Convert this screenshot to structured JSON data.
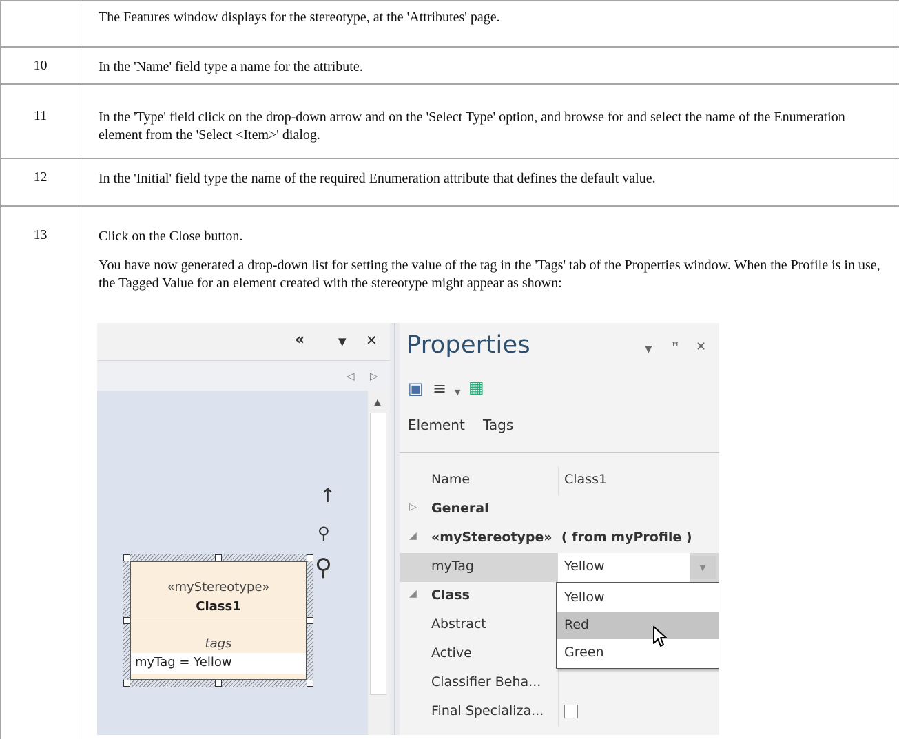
{
  "rows": [
    {
      "num": "",
      "text": "The Features window displays for the stereotype, at the 'Attributes' page."
    },
    {
      "num": "10",
      "text": "In the 'Name' field type a name for the attribute."
    },
    {
      "num": "11",
      "text": "In the 'Type' field click on the drop-down arrow and on the 'Select Type' option, and browse for and select the name of the Enumeration element from the 'Select <Item>' dialog."
    },
    {
      "num": "12",
      "text": "In the 'Initial' field type the name of the required Enumeration attribute that defines the default value."
    },
    {
      "num": "13",
      "text": "Click on the Close button.",
      "text2": "You have now generated a drop-down list for setting the value of the tag in the 'Tags' tab of the Properties window. When the Profile is in use, the Tagged Value for an element created with the stereotype might appear as shown:"
    }
  ],
  "screenshot": {
    "left_panel": {
      "icons": [
        "collapse-icon",
        "dropdown-icon",
        "close-icon",
        "prev-icon",
        "next-icon"
      ],
      "class_element": {
        "stereotype": "«myStereotype»",
        "name": "Class1",
        "tags_label": "tags",
        "tag_line": "myTag = Yellow"
      }
    },
    "properties": {
      "title": "Properties",
      "tabs": [
        "Element",
        "Tags"
      ],
      "grid": [
        {
          "key": "Name",
          "value": "Class1"
        },
        {
          "key": "General",
          "value": "",
          "group": true
        },
        {
          "key": "«myStereotype»  ( from myProfile )",
          "value": "",
          "group": true
        },
        {
          "key": "myTag",
          "value": "Yellow",
          "selected": true
        },
        {
          "key": "Class",
          "value": "",
          "group": true
        },
        {
          "key": "Abstract",
          "value": ""
        },
        {
          "key": "Active",
          "value": ""
        },
        {
          "key": "Classifier Beha...",
          "value": ""
        },
        {
          "key": "Final Specializa...",
          "value": ""
        }
      ],
      "dropdown_options": [
        "Yellow",
        "Red",
        "Green"
      ],
      "highlighted_option": "Red"
    }
  }
}
